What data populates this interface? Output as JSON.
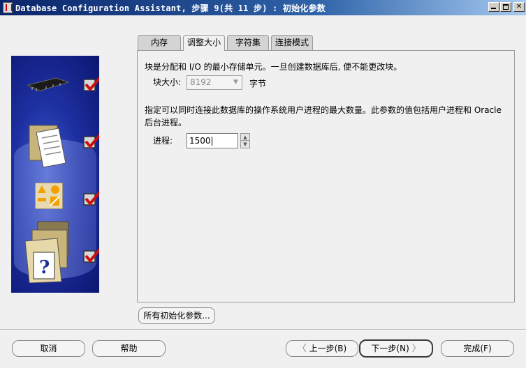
{
  "window": {
    "title": "Database Configuration Assistant, 步骤 9(共 11 步) : 初始化参数"
  },
  "tabs": [
    {
      "label": "内存",
      "active": false
    },
    {
      "label": "调整大小",
      "active": true
    },
    {
      "label": "字符集",
      "active": false
    },
    {
      "label": "连接模式",
      "active": false
    }
  ],
  "panel": {
    "block_description": "块是分配和 I/O 的最小存储单元。一旦创建数据库后, 便不能更改块。",
    "block_size_label": "块大小:",
    "block_size_value": "8192",
    "block_size_unit": "字节",
    "process_description": "指定可以同时连接此数据库的操作系统用户进程的最大数量。此参数的值包括用户进程和 Oracle 后台进程。",
    "process_label": "进程:",
    "process_value": "1500"
  },
  "buttons": {
    "all_params": "所有初始化参数...",
    "cancel": "取消",
    "help": "帮助",
    "prev": "上一步(B)",
    "next": "下一步(N)",
    "finish": "完成(F)"
  },
  "colors": {
    "titlebar": "#0a246a",
    "illustration_bg": "#1d2fa0",
    "check": "#cc1010"
  }
}
